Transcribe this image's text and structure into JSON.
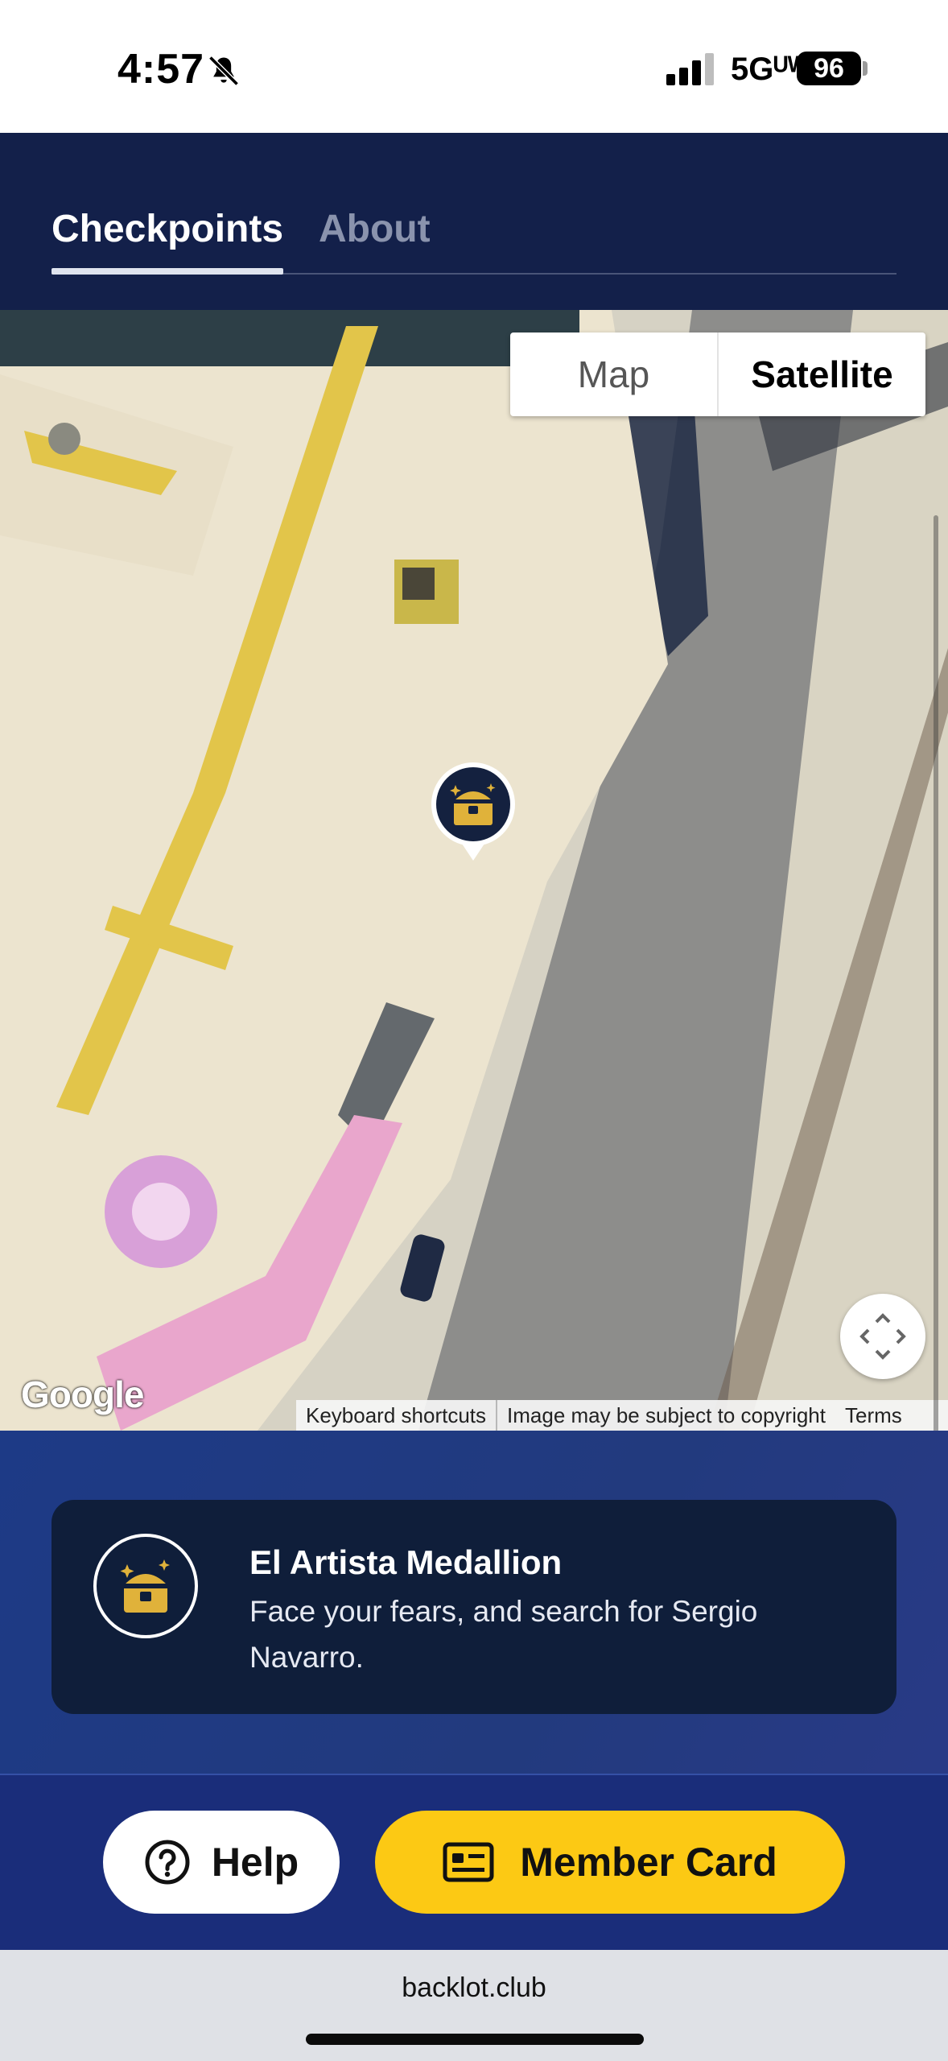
{
  "status_bar": {
    "time": "4:57",
    "network": "5Gᵁᵂ",
    "battery": "96",
    "icons": [
      "bell-slash-icon",
      "signal-icon",
      "battery-icon"
    ]
  },
  "tabs": [
    {
      "label": "Checkpoints",
      "active": true
    },
    {
      "label": "About",
      "active": false
    }
  ],
  "map": {
    "type_toggle": {
      "map_label": "Map",
      "satellite_label": "Satellite",
      "selected": "Satellite"
    },
    "google_logo": "Google",
    "attribution": {
      "shortcuts": "Keyboard shortcuts",
      "copyright": "Image may be subject to copyright",
      "terms": "Terms"
    },
    "marker_icon": "treasure-chest-icon",
    "fullscreen_icon": "fullscreen-icon"
  },
  "checkpoint": {
    "title": "El Artista Medallion",
    "description": "Face your fears, and search for Sergio Navarro.",
    "icon": "treasure-chest-icon"
  },
  "actions": {
    "help_label": "Help",
    "help_icon": "question-circle-icon",
    "member_label": "Member Card",
    "member_icon": "id-card-icon"
  },
  "browser": {
    "url": "backlot.club"
  },
  "colors": {
    "header_bg": "#13204a",
    "card_bg": "#0f1e3a",
    "accent_yellow": "#fcc914",
    "bottom_bg": "#1d3a86"
  }
}
